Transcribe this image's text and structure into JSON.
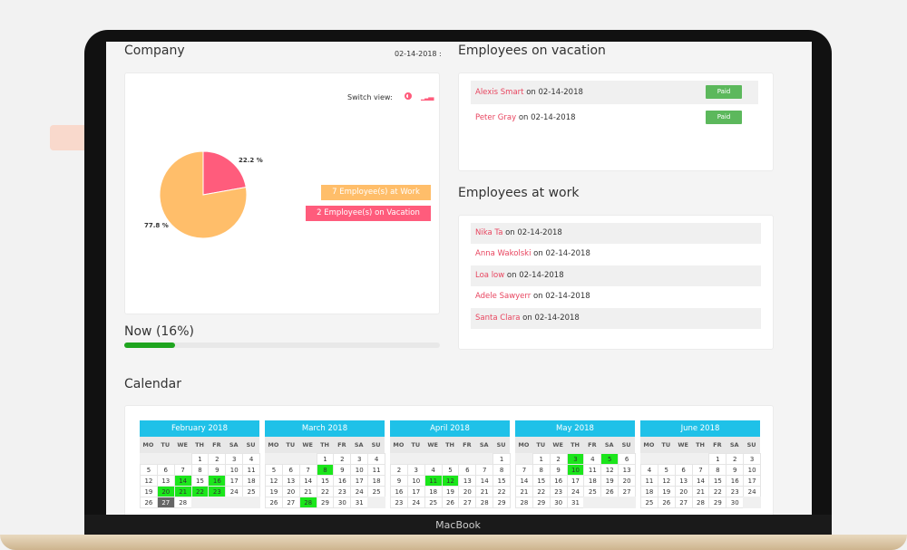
{
  "company": {
    "title": "Company",
    "date": "02-14-2018 :",
    "switch_label": "Switch view:",
    "pie_icon": "pie-chart-icon",
    "bar_icon": "bar-chart-icon",
    "chart_data": {
      "type": "pie",
      "slices": [
        {
          "label": "Employees at Work",
          "value": 77.8,
          "text": "77.8 %",
          "color": "#ffbe6a"
        },
        {
          "label": "Employees on Vacation",
          "value": 22.2,
          "text": "22.2 %",
          "color": "#ff5c7c"
        }
      ]
    },
    "legend_work": "7 Employee(s) at Work",
    "legend_vacation": "2 Employee(s) on Vacation"
  },
  "now": {
    "label": "Now (16%)",
    "percent": 16,
    "color": "#1fa51f"
  },
  "vacation": {
    "title": "Employees on vacation",
    "items": [
      {
        "name": "Alexis Smart",
        "date": "on 02-14-2018",
        "badge": "Paid"
      },
      {
        "name": "Peter Gray",
        "date": "on 02-14-2018",
        "badge": "Paid"
      }
    ]
  },
  "work": {
    "title": "Employees at work",
    "items": [
      {
        "name": "Nika Ta",
        "date": "on 02-14-2018"
      },
      {
        "name": "Anna Wakolski",
        "date": "on 02-14-2018"
      },
      {
        "name": "Loa low",
        "date": "on 02-14-2018"
      },
      {
        "name": "Adele Sawyerr",
        "date": "on 02-14-2018"
      },
      {
        "name": "Santa Clara",
        "date": "on 02-14-2018"
      }
    ]
  },
  "calendar": {
    "title": "Calendar",
    "dow": [
      "MO",
      "TU",
      "WE",
      "TH",
      "FR",
      "SA",
      "SU"
    ],
    "months": [
      {
        "name": "February 2018",
        "offset": 3,
        "days": 28,
        "highlight": [
          14,
          16,
          20,
          21,
          22,
          23
        ],
        "today": 27
      },
      {
        "name": "March 2018",
        "offset": 3,
        "days": 31,
        "highlight": [
          8,
          28
        ],
        "today": null
      },
      {
        "name": "April 2018",
        "offset": 6,
        "days": 30,
        "highlight": [
          11,
          12
        ],
        "today": null
      },
      {
        "name": "May 2018",
        "offset": 1,
        "days": 31,
        "highlight": [
          3,
          5,
          10
        ],
        "today": null
      },
      {
        "name": "June 2018",
        "offset": 4,
        "days": 30,
        "highlight": [],
        "today": null
      }
    ]
  },
  "device": {
    "label": "MacBook"
  }
}
